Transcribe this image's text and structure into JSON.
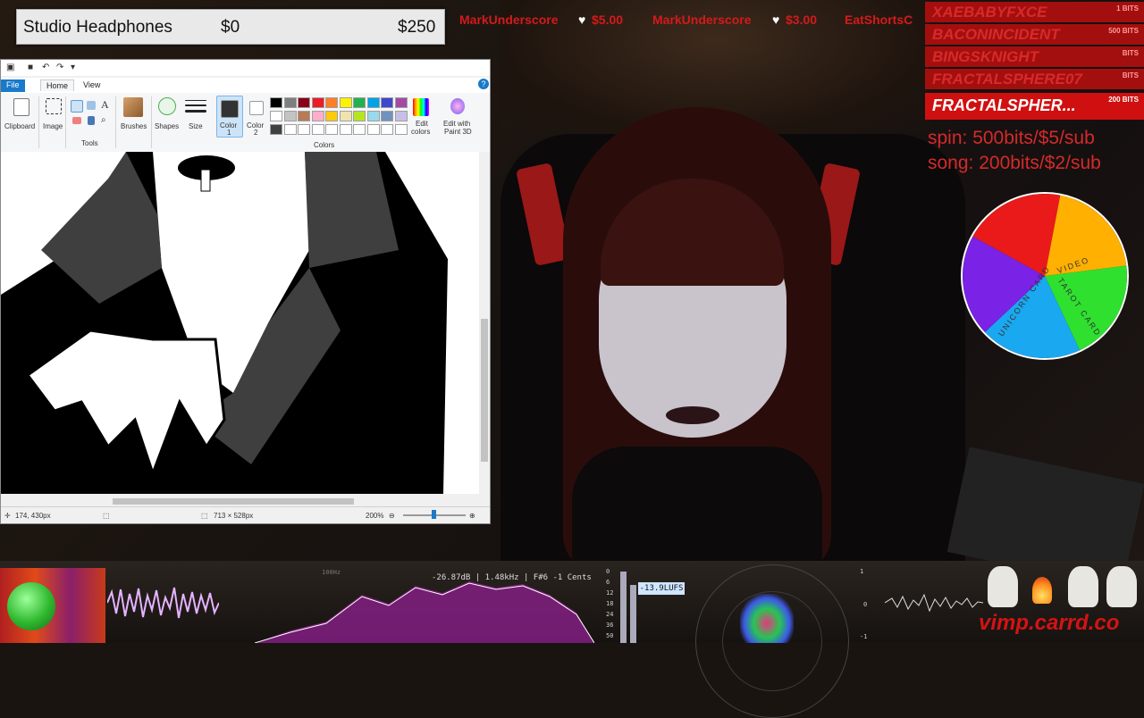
{
  "item_bar": {
    "name": "Studio Headphones",
    "raised": "$0",
    "goal": "$250"
  },
  "ticker": [
    {
      "user": "MarkUnderscore",
      "amount": "$5.00"
    },
    {
      "user": "MarkUnderscore",
      "amount": "$3.00"
    },
    {
      "user": "EatShortsC"
    }
  ],
  "bits_board": [
    {
      "name": "XAEBABYFXCE",
      "amount": "1 BITS"
    },
    {
      "name": "BACONINCIDENT",
      "amount": "500 BITS"
    },
    {
      "name": "BINGSKNIGHT",
      "amount": "BITS"
    },
    {
      "name": "FRACTALSPHERE07",
      "amount": "BITS"
    },
    {
      "name": "FRACTALSPHER...",
      "amount": "200 BITS"
    }
  ],
  "info": {
    "spin": "spin: 500bits/$5/sub",
    "song": "song: 200bits/$2/sub"
  },
  "wheel": {
    "segments": [
      {
        "label": "VIDEO",
        "color": "#ffb000"
      },
      {
        "label": "TAROT CARD",
        "color": "#2fe02f"
      },
      {
        "label": "UNICORN CARD",
        "color": "#1aa8f0"
      },
      {
        "label": "",
        "color": "#7a22e6"
      },
      {
        "label": "",
        "color": "#ea1a1a"
      }
    ]
  },
  "paint": {
    "menu": {
      "file": "File",
      "home": "Home",
      "view": "View",
      "help": "?"
    },
    "ribbon": {
      "clipboard": "Clipboard",
      "image": "Image",
      "tools": "Tools",
      "brushes": "Brushes",
      "shapes": "Shapes",
      "size": "Size",
      "color1": "Color\n1",
      "color1_a": "Color",
      "color1_b": "1",
      "color2_a": "Color",
      "color2_b": "2",
      "colors": "Colors",
      "edit_colors_a": "Edit",
      "edit_colors_b": "colors",
      "paint3d_a": "Edit with",
      "paint3d_b": "Paint 3D"
    },
    "palette": [
      "#000000",
      "#7f7f7f",
      "#880015",
      "#ed1c24",
      "#ff7f27",
      "#fff200",
      "#22b14c",
      "#00a2e8",
      "#3f48cc",
      "#a349a4",
      "#ffffff",
      "#c3c3c3",
      "#b97a57",
      "#ffaec9",
      "#ffc90e",
      "#efe4b0",
      "#b5e61d",
      "#99d9ea",
      "#7092be",
      "#c8bfe7",
      "#404040",
      "#ffffff",
      "#ffffff",
      "#ffffff",
      "#ffffff",
      "#ffffff",
      "#ffffff",
      "#ffffff",
      "#ffffff",
      "#ffffff"
    ],
    "status": {
      "cursor": "174, 430px",
      "size": "713 × 528px",
      "zoom": "200%"
    }
  },
  "audio": {
    "readout": "-26.87dB | 1.48kHz | F#6 -1  Cents",
    "lufs": "-13.9LUFS",
    "meter_ticks": [
      "0",
      "6",
      "12",
      "18",
      "24",
      "36",
      "50"
    ],
    "freq_label": "100Hz",
    "scope_ticks": [
      "1",
      "0",
      "-1"
    ]
  },
  "watermark": "vimp.carrd.co"
}
